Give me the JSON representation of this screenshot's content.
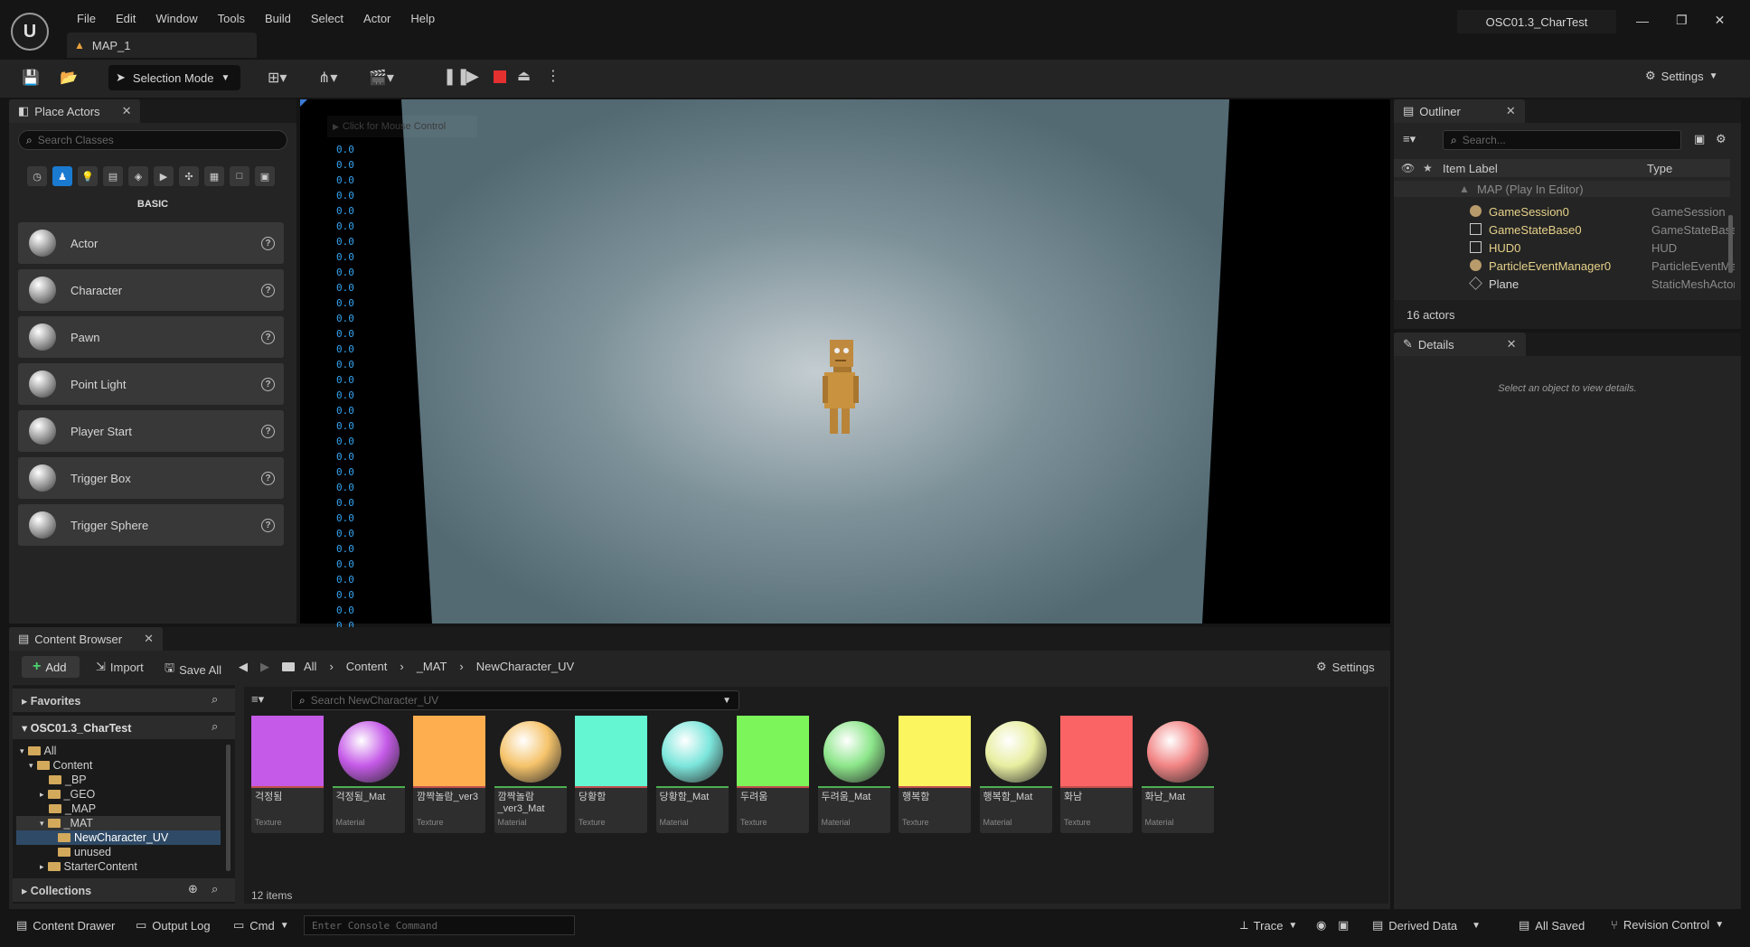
{
  "menu": [
    "File",
    "Edit",
    "Window",
    "Tools",
    "Build",
    "Select",
    "Actor",
    "Help"
  ],
  "level_tab": "MAP_1",
  "project_name": "OSC01.3_CharTest",
  "toolbar": {
    "selection_mode": "Selection Mode",
    "settings": "Settings"
  },
  "place_actors": {
    "tab": "Place Actors",
    "search_placeholder": "Search Classes",
    "category": "BASIC",
    "items": [
      "Actor",
      "Character",
      "Pawn",
      "Point Light",
      "Player Start",
      "Trigger Box",
      "Trigger Sphere"
    ]
  },
  "viewport": {
    "mouse_hint": "Click for Mouse Control",
    "readout": [
      "0.0",
      "0.0",
      "0.0",
      "0.0",
      "0.0",
      "0.0",
      "0.0",
      "0.0",
      "0.0",
      "0.0",
      "0.0",
      "0.0",
      "0.0",
      "0.0",
      "0.0",
      "0.0",
      "0.0",
      "0.0",
      "0.0",
      "0.0",
      "0.0",
      "0.0",
      "0.0",
      "0.0",
      "0.0",
      "0.0",
      "0.0",
      "0.0",
      "0.0",
      "0.0",
      "0.0",
      "0.0"
    ]
  },
  "outliner": {
    "tab": "Outliner",
    "search_placeholder": "Search...",
    "col_label": "Item Label",
    "col_type": "Type",
    "root": "MAP (Play In Editor)",
    "rows": [
      {
        "label": "GameSession0",
        "type": "GameSession"
      },
      {
        "label": "GameStateBase0",
        "type": "GameStateBase"
      },
      {
        "label": "HUD0",
        "type": "HUD"
      },
      {
        "label": "ParticleEventManager0",
        "type": "ParticleEventManager"
      },
      {
        "label": "Plane",
        "type": "StaticMeshActor"
      }
    ],
    "count": "16 actors"
  },
  "details": {
    "tab": "Details",
    "empty": "Select an object to view details."
  },
  "content_browser": {
    "tab": "Content Browser",
    "add": "Add",
    "import": "Import",
    "save_all": "Save All",
    "path": [
      "All",
      "Content",
      "_MAT",
      "NewCharacter_UV"
    ],
    "settings": "Settings",
    "favorites": "Favorites",
    "project": "OSC01.3_CharTest",
    "tree": [
      "All",
      "Content",
      "_BP",
      "_GEO",
      "_MAP",
      "_MAT",
      "NewCharacter_UV",
      "unused",
      "StarterContent"
    ],
    "collections": "Collections",
    "search_placeholder": "Search NewCharacter_UV",
    "assets": [
      {
        "name": "걱정됨",
        "kind": "Texture",
        "color": "#c55ae8"
      },
      {
        "name": "걱정됨_Mat",
        "kind": "Material",
        "color": "#c55ae8"
      },
      {
        "name": "깜짝놀람_ver3",
        "kind": "Texture",
        "color": "#ffae4f"
      },
      {
        "name": "깜짝놀람_ver3_Mat",
        "kind": "Material",
        "color": "#f5c36a"
      },
      {
        "name": "당황함",
        "kind": "Texture",
        "color": "#64f5d3"
      },
      {
        "name": "당황함_Mat",
        "kind": "Material",
        "color": "#7ce6dc"
      },
      {
        "name": "두려움",
        "kind": "Texture",
        "color": "#7cf55a"
      },
      {
        "name": "두려움_Mat",
        "kind": "Material",
        "color": "#8ce68a"
      },
      {
        "name": "행복함",
        "kind": "Texture",
        "color": "#fbf55f"
      },
      {
        "name": "행복함_Mat",
        "kind": "Material",
        "color": "#e8eea0"
      },
      {
        "name": "화남",
        "kind": "Texture",
        "color": "#fb6464"
      },
      {
        "name": "화남_Mat",
        "kind": "Material",
        "color": "#f28484"
      }
    ],
    "count": "12 items"
  },
  "statusbar": {
    "content_drawer": "Content Drawer",
    "output_log": "Output Log",
    "cmd": "Cmd",
    "console_placeholder": "Enter Console Command",
    "trace": "Trace",
    "derived_data": "Derived Data",
    "all_saved": "All Saved",
    "revision_control": "Revision Control"
  }
}
